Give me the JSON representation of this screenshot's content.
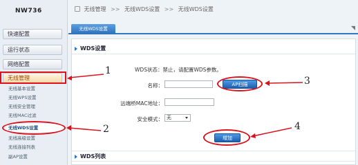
{
  "sidebar": {
    "model": "NW736",
    "categories": [
      {
        "label": "快速配置"
      },
      {
        "label": "运行状态"
      },
      {
        "label": "网络配置"
      },
      {
        "label": "无线管理"
      }
    ],
    "wireless_items": [
      {
        "label": "无线基本设置"
      },
      {
        "label": "无线WPS设置"
      },
      {
        "label": "无线安全管理"
      },
      {
        "label": "无线MAC过滤"
      },
      {
        "label": "无线WDS设置"
      },
      {
        "label": "无线高级设置"
      },
      {
        "label": "无线连接列表"
      },
      {
        "label": "副AP设置"
      }
    ]
  },
  "breadcrumb": {
    "items": [
      "无线管理",
      "无线WDS设置",
      "无线WDS设置"
    ],
    "separator": ">>"
  },
  "tab": {
    "label": "无线WDS设置"
  },
  "wds_settings": {
    "section_title": "WDS设置",
    "status_text": "WDS状态：禁止，请配置WDS参数。",
    "name_label": "名称：",
    "ap_scan_button": "AP扫描",
    "bridge_mac_label": "远端桥MAC地址：",
    "security_mode_label": "安全模式：",
    "security_mode_value": "无",
    "add_button": "增加"
  },
  "wds_list": {
    "section_title": "WDS列表"
  },
  "annotations": {
    "numbers": [
      "1",
      "2",
      "3",
      "4"
    ],
    "color": "#d9121b"
  },
  "colors": {
    "accent_blue": "#2f77c2",
    "sidebar_bg": "#e8eef3"
  }
}
